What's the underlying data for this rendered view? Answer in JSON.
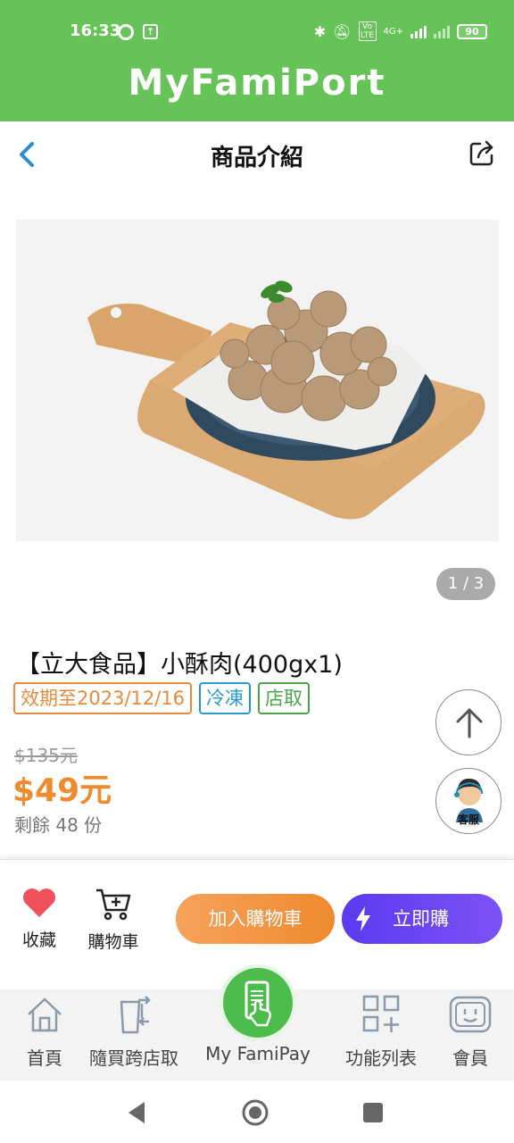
{
  "status_bar": {
    "time": "16:33",
    "battery": "90",
    "network": "4G+",
    "volte": "Vo LTE"
  },
  "brand": {
    "logo_text": "MyFamiPort"
  },
  "header": {
    "title": "商品介紹",
    "back_icon": "chevron-left-icon",
    "share_icon": "share-icon"
  },
  "gallery": {
    "counter": "1 / 3"
  },
  "product": {
    "name": "【立大食品】小酥肉(400gx1)",
    "tags": {
      "expiry": "效期至2023/12/16",
      "frozen": "冷凍",
      "pickup": "店取"
    },
    "original_price": "$135元",
    "sale_price": "$49元",
    "remaining": "剩餘 48 份"
  },
  "floating": {
    "customer_service_label": "客服"
  },
  "actions": {
    "favorite": "收藏",
    "cart": "購物車",
    "add_to_cart": "加入購物車",
    "buy_now": "立即購"
  },
  "bottom_nav": {
    "home": "首頁",
    "cross_store": "隨買跨店取",
    "pay": "My FamiPay",
    "functions": "功能列表",
    "member": "會員"
  },
  "colors": {
    "brand_green": "#66c357",
    "orange": "#f08a2e",
    "purple": "#6a45f2",
    "frozen_blue": "#2a9bd0",
    "pickup_green": "#4ca448"
  }
}
